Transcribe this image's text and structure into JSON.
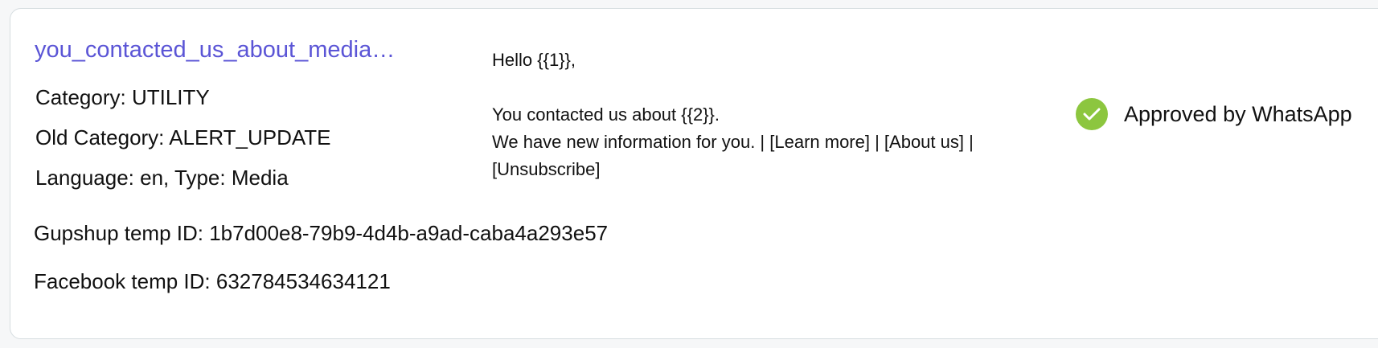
{
  "template": {
    "name": "you_contacted_us_about_media…",
    "category": "Category: UTILITY",
    "old_category": "Old Category: ALERT_UPDATE",
    "language_type": "Language: en, Type: Media",
    "gupshup_id": "Gupshup temp ID: 1b7d00e8-79b9-4d4b-a9ad-caba4a293e57",
    "facebook_id": "Facebook temp ID: 632784534634121"
  },
  "body": {
    "greeting": "Hello {{1}},",
    "line1": "You contacted us about {{2}}.",
    "line2": "We have new information for you. | [Learn more] | [About us] |",
    "line3": "[Unsubscribe]"
  },
  "status": {
    "label": "Approved by WhatsApp",
    "icon": "check-circle-icon",
    "color": "#8cc63f"
  },
  "colors": {
    "link": "#5b55d6",
    "card_border": "#d6dde0"
  }
}
